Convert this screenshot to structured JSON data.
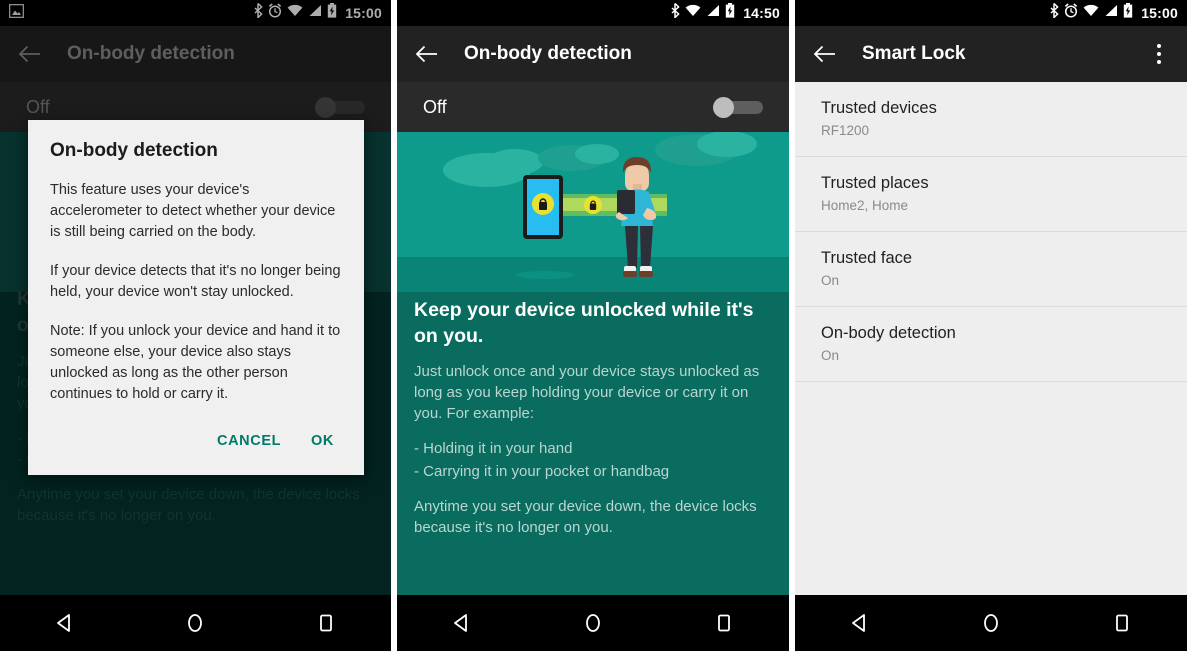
{
  "panels": [
    {
      "id": "panel-1",
      "status_bar": {
        "notification_icon": "photo-icon",
        "icons": [
          "bluetooth-icon",
          "alarm-icon",
          "wifi-icon",
          "signal-icon",
          "battery-charging-icon"
        ],
        "clock": "15:00"
      },
      "action_bar": {
        "back_icon": "back-arrow-icon",
        "title": "On-body detection"
      },
      "switch_row": {
        "label": "Off",
        "state": "off"
      },
      "background_content": {
        "heading": "Keep your device unlocked while it's on you.",
        "paragraph_1": "Just unlock once and your device stays unlocked as long as you keep holding your device or carry it on you. For example:",
        "paragraph_2": "- Holding it in your hand\n- Carrying it in your pocket or handbag",
        "paragraph_3": "Anytime you set your device down, the device locks because it's no longer on you."
      },
      "dialog": {
        "title": "On-body detection",
        "paragraph_1": "This feature uses your device's accelerometer to detect whether your device is still being carried on the body.",
        "paragraph_2": "If your device detects that it's no longer being held, your device won't stay unlocked.",
        "paragraph_3": "Note: If you unlock your device and hand it to someone else, your device also stays unlocked as long as the other person continues to hold or carry it.",
        "cancel_label": "CANCEL",
        "ok_label": "OK"
      },
      "nav_bar": {
        "back": "nav-back-icon",
        "home": "nav-home-icon",
        "recents": "nav-recents-icon"
      }
    },
    {
      "id": "panel-2",
      "status_bar": {
        "icons": [
          "bluetooth-icon",
          "wifi-icon",
          "signal-icon",
          "battery-charging-icon"
        ],
        "clock": "14:50"
      },
      "action_bar": {
        "back_icon": "back-arrow-icon",
        "title": "On-body detection"
      },
      "switch_row": {
        "label": "Off",
        "state": "off"
      },
      "illustration": {
        "name": "person-holding-phone-with-lock-illustration"
      },
      "content": {
        "heading": "Keep your device unlocked while it's on you.",
        "paragraph_1": "Just unlock once and your device stays unlocked as long as you keep holding your device or carry it on you. For example:",
        "bullet_1": "- Holding it in your hand",
        "bullet_2": "- Carrying it in your pocket or handbag",
        "paragraph_2": "Anytime you set your device down, the device locks because it's no longer on you."
      },
      "nav_bar": {
        "back": "nav-back-icon",
        "home": "nav-home-icon",
        "recents": "nav-recents-icon"
      }
    },
    {
      "id": "panel-3",
      "status_bar": {
        "icons": [
          "bluetooth-icon",
          "alarm-icon",
          "wifi-icon",
          "signal-icon",
          "battery-charging-icon"
        ],
        "clock": "15:00"
      },
      "action_bar": {
        "back_icon": "back-arrow-icon",
        "title": "Smart Lock",
        "overflow_icon": "overflow-menu-icon"
      },
      "list": [
        {
          "title": "Trusted devices",
          "subtitle": "RF1200"
        },
        {
          "title": "Trusted places",
          "subtitle": "Home2, Home"
        },
        {
          "title": "Trusted face",
          "subtitle": "On"
        },
        {
          "title": "On-body detection",
          "subtitle": "On"
        }
      ],
      "nav_bar": {
        "back": "nav-back-icon",
        "home": "nav-home-icon",
        "recents": "nav-recents-icon"
      }
    }
  ],
  "colors": {
    "accent_teal": "#00796b",
    "illustration_bg": "#0f9b8b",
    "panel_bg": "#0a6b5f",
    "dimmed_panel_bg": "#04342f",
    "list_bg": "#eeeeee",
    "action_bar_dark": "#222222"
  }
}
